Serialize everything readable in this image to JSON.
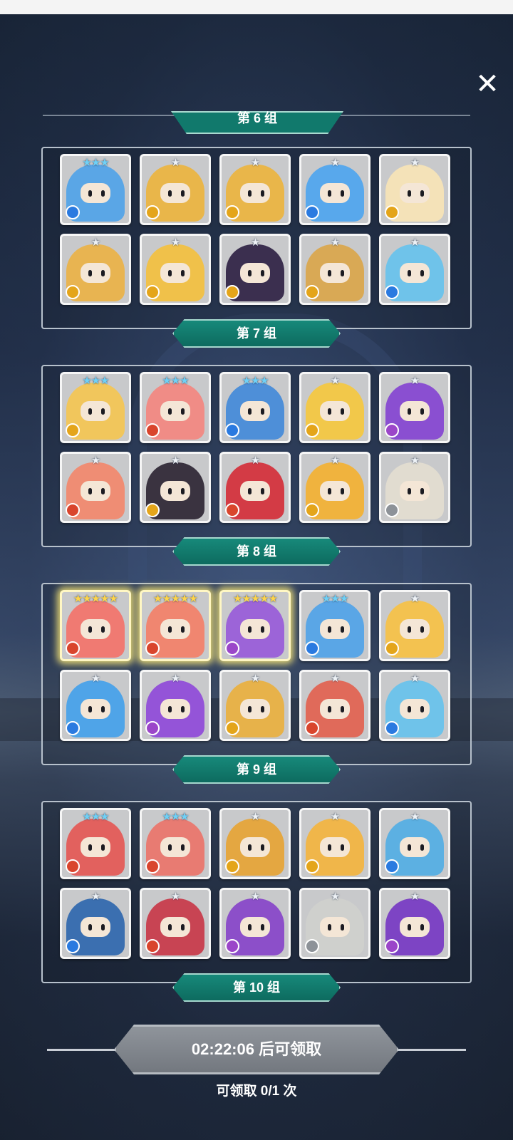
{
  "ui": {
    "close_icon": "close-icon",
    "top_banner_label": "第 6 组"
  },
  "groups": [
    {
      "banner": "第 7 组",
      "heroes": [
        {
          "stars": "★★★",
          "tier": 3,
          "element": "water",
          "color": "#5aa6e6"
        },
        {
          "stars": "★",
          "tier": 1,
          "element": "earth",
          "color": "#e9b64a"
        },
        {
          "stars": "★",
          "tier": 1,
          "element": "earth",
          "color": "#e9b64a"
        },
        {
          "stars": "★",
          "tier": 1,
          "element": "water",
          "color": "#58a8ec"
        },
        {
          "stars": "★",
          "tier": 1,
          "element": "earth",
          "color": "#f4e2b8"
        },
        {
          "stars": "★",
          "tier": 1,
          "element": "earth",
          "color": "#e8b451"
        },
        {
          "stars": "★",
          "tier": 1,
          "element": "earth",
          "color": "#f0c14a"
        },
        {
          "stars": "★",
          "tier": 1,
          "element": "earth",
          "color": "#3b2f4f"
        },
        {
          "stars": "★",
          "tier": 1,
          "element": "earth",
          "color": "#d9a955"
        },
        {
          "stars": "★",
          "tier": 1,
          "element": "water",
          "color": "#6fc3ea"
        }
      ]
    },
    {
      "banner": "第 8 组",
      "heroes": [
        {
          "stars": "★★★",
          "tier": 3,
          "element": "earth",
          "color": "#f1c65c"
        },
        {
          "stars": "★★★",
          "tier": 3,
          "element": "fire",
          "color": "#f08c86"
        },
        {
          "stars": "★★★",
          "tier": 3,
          "element": "water",
          "color": "#4e8fd8"
        },
        {
          "stars": "★",
          "tier": 1,
          "element": "earth",
          "color": "#f2c84a"
        },
        {
          "stars": "★",
          "tier": 1,
          "element": "dark",
          "color": "#8a4fd1"
        },
        {
          "stars": "★",
          "tier": 1,
          "element": "fire",
          "color": "#ef8d74"
        },
        {
          "stars": "★",
          "tier": 1,
          "element": "earth",
          "color": "#3a3340"
        },
        {
          "stars": "★",
          "tier": 1,
          "element": "fire",
          "color": "#d33b45"
        },
        {
          "stars": "★",
          "tier": 1,
          "element": "earth",
          "color": "#f0b33e"
        },
        {
          "stars": "★",
          "tier": 1,
          "element": "light",
          "color": "#e1dcd0"
        }
      ]
    },
    {
      "banner": "第 9 组",
      "heroes": [
        {
          "stars": "★★★★★",
          "tier": 5,
          "element": "fire",
          "color": "#f07a72"
        },
        {
          "stars": "★★★★★",
          "tier": 5,
          "element": "fire",
          "color": "#f08670"
        },
        {
          "stars": "★★★★★",
          "tier": 5,
          "element": "dark",
          "color": "#9c64d8"
        },
        {
          "stars": "★★★",
          "tier": 3,
          "element": "water",
          "color": "#5aa6e6"
        },
        {
          "stars": "★",
          "tier": 1,
          "element": "earth",
          "color": "#f3c250"
        },
        {
          "stars": "★",
          "tier": 1,
          "element": "water",
          "color": "#4fa4e8"
        },
        {
          "stars": "★",
          "tier": 1,
          "element": "dark",
          "color": "#9454d8"
        },
        {
          "stars": "★",
          "tier": 1,
          "element": "earth",
          "color": "#e7b24a"
        },
        {
          "stars": "★",
          "tier": 1,
          "element": "fire",
          "color": "#e06a5a"
        },
        {
          "stars": "★",
          "tier": 1,
          "element": "water",
          "color": "#6fc3ea"
        }
      ]
    },
    {
      "banner": "第 10 组",
      "heroes": [
        {
          "stars": "★★★",
          "tier": 3,
          "element": "fire",
          "color": "#e2615e"
        },
        {
          "stars": "★★★",
          "tier": 3,
          "element": "fire",
          "color": "#e87b72"
        },
        {
          "stars": "★",
          "tier": 1,
          "element": "earth",
          "color": "#e4a741"
        },
        {
          "stars": "★",
          "tier": 1,
          "element": "earth",
          "color": "#f0b64a"
        },
        {
          "stars": "★",
          "tier": 1,
          "element": "water",
          "color": "#5cb0e2"
        },
        {
          "stars": "★",
          "tier": 1,
          "element": "water",
          "color": "#3b6fb0"
        },
        {
          "stars": "★",
          "tier": 1,
          "element": "fire",
          "color": "#c84453"
        },
        {
          "stars": "★",
          "tier": 1,
          "element": "dark",
          "color": "#8c4fc9"
        },
        {
          "stars": "★",
          "tier": 1,
          "element": "light",
          "color": "#cfd0cd"
        },
        {
          "stars": "★",
          "tier": 1,
          "element": "dark",
          "color": "#7d44c4"
        }
      ]
    }
  ],
  "footer": {
    "timer_text": "02:22:06 后可领取",
    "claim_count": "可领取 0/1 次"
  }
}
